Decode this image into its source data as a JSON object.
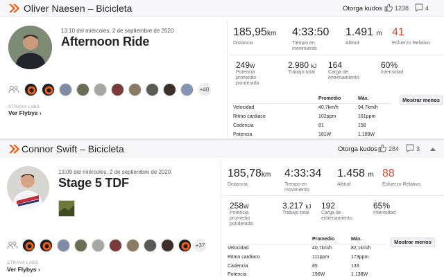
{
  "colors": {
    "brand": "#fc5200",
    "red": "#e34a33"
  },
  "activities": [
    {
      "title": "Oliver Naesen – Bicicleta",
      "kudos_label": "Otorga kudos",
      "kudos_count": "1238",
      "comments_count": "4",
      "date": "13:10 del miércoles, 2 de septiembre de 2020",
      "name": "Afternoon Ride",
      "stats": [
        {
          "value": "185,95",
          "unit": "km",
          "label": "Distancia"
        },
        {
          "value": "4:33:50",
          "unit": "",
          "label": "Tiempo en movimiento"
        },
        {
          "value": "1.491",
          "unit": "m",
          "label": "Altitud"
        },
        {
          "value": "41",
          "unit": "",
          "label": "Esfuerzo Relativo"
        }
      ],
      "substats": [
        {
          "value": "249",
          "unit": "W",
          "label": "Potencia promedio ponderada"
        },
        {
          "value": "2.980",
          "unit": "kJ",
          "label": "Trabajo total"
        },
        {
          "value": "164",
          "unit": "",
          "label": "Carga de entrenamiento"
        },
        {
          "value": "60%",
          "unit": "",
          "label": "Intensidad"
        }
      ],
      "table": {
        "h_avg": "Promedio",
        "h_max": "Máx.",
        "rows": [
          {
            "label": "Velocidad",
            "avg": "40,7km/h",
            "max": "94,7km/h"
          },
          {
            "label": "Ritmo cardiaco",
            "avg": "102ppm",
            "max": "161ppm"
          },
          {
            "label": "Cadencia",
            "avg": "81",
            "max": "158"
          },
          {
            "label": "Potencia",
            "avg": "181W",
            "max": "1.189W"
          }
        ]
      },
      "more_label": "Mostrar menos",
      "plus_athletes": "+40",
      "labs": "STRAVA LABS",
      "flyby": "Ver Flybys ›"
    },
    {
      "title": "Connor Swift – Bicicleta",
      "kudos_label": "Otorga kudos",
      "kudos_count": "284",
      "comments_count": "3",
      "date": "13:09 del miércoles, 2 de septiembre de 2020",
      "name": "Stage 5 TDF",
      "stats": [
        {
          "value": "185,78",
          "unit": "km",
          "label": "Distancia"
        },
        {
          "value": "4:33:34",
          "unit": "",
          "label": "Tiempo en movimiento"
        },
        {
          "value": "1.458",
          "unit": "m",
          "label": "Altitud"
        },
        {
          "value": "88",
          "unit": "",
          "label": "Esfuerzo Relativo"
        }
      ],
      "substats": [
        {
          "value": "258",
          "unit": "W",
          "label": "Potencia promedio ponderada"
        },
        {
          "value": "3.217",
          "unit": "kJ",
          "label": "Trabajo total"
        },
        {
          "value": "192",
          "unit": "",
          "label": "Carga de entrenamiento"
        },
        {
          "value": "65%",
          "unit": "",
          "label": "Intensidad"
        }
      ],
      "table": {
        "h_avg": "Promedio",
        "h_max": "Máx.",
        "rows": [
          {
            "label": "Velocidad",
            "avg": "40,7km/h",
            "max": "82,1km/h"
          },
          {
            "label": "Ritmo cardiaco",
            "avg": "111ppm",
            "max": "173ppm"
          },
          {
            "label": "Cadencia",
            "avg": "85",
            "max": "133"
          },
          {
            "label": "Potencia",
            "avg": "196W",
            "max": "1.138W"
          }
        ]
      },
      "more_label": "Mostrar menos",
      "plus_athletes": "+37",
      "labs": "STRAVA LABS",
      "flyby": "Ver Flybys ›"
    }
  ]
}
